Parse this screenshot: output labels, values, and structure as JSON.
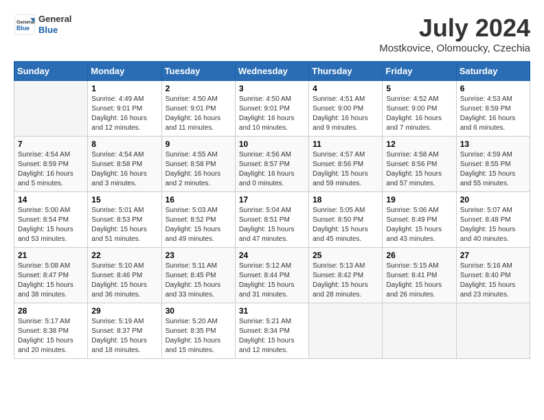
{
  "header": {
    "logo_general": "General",
    "logo_blue": "Blue",
    "month_title": "July 2024",
    "location": "Mostkovice, Olomoucky, Czechia"
  },
  "days_of_week": [
    "Sunday",
    "Monday",
    "Tuesday",
    "Wednesday",
    "Thursday",
    "Friday",
    "Saturday"
  ],
  "weeks": [
    [
      {
        "day": "",
        "info": ""
      },
      {
        "day": "1",
        "info": "Sunrise: 4:49 AM\nSunset: 9:01 PM\nDaylight: 16 hours\nand 12 minutes."
      },
      {
        "day": "2",
        "info": "Sunrise: 4:50 AM\nSunset: 9:01 PM\nDaylight: 16 hours\nand 11 minutes."
      },
      {
        "day": "3",
        "info": "Sunrise: 4:50 AM\nSunset: 9:01 PM\nDaylight: 16 hours\nand 10 minutes."
      },
      {
        "day": "4",
        "info": "Sunrise: 4:51 AM\nSunset: 9:00 PM\nDaylight: 16 hours\nand 9 minutes."
      },
      {
        "day": "5",
        "info": "Sunrise: 4:52 AM\nSunset: 9:00 PM\nDaylight: 16 hours\nand 7 minutes."
      },
      {
        "day": "6",
        "info": "Sunrise: 4:53 AM\nSunset: 8:59 PM\nDaylight: 16 hours\nand 6 minutes."
      }
    ],
    [
      {
        "day": "7",
        "info": "Sunrise: 4:54 AM\nSunset: 8:59 PM\nDaylight: 16 hours\nand 5 minutes."
      },
      {
        "day": "8",
        "info": "Sunrise: 4:54 AM\nSunset: 8:58 PM\nDaylight: 16 hours\nand 3 minutes."
      },
      {
        "day": "9",
        "info": "Sunrise: 4:55 AM\nSunset: 8:58 PM\nDaylight: 16 hours\nand 2 minutes."
      },
      {
        "day": "10",
        "info": "Sunrise: 4:56 AM\nSunset: 8:57 PM\nDaylight: 16 hours\nand 0 minutes."
      },
      {
        "day": "11",
        "info": "Sunrise: 4:57 AM\nSunset: 8:56 PM\nDaylight: 15 hours\nand 59 minutes."
      },
      {
        "day": "12",
        "info": "Sunrise: 4:58 AM\nSunset: 8:56 PM\nDaylight: 15 hours\nand 57 minutes."
      },
      {
        "day": "13",
        "info": "Sunrise: 4:59 AM\nSunset: 8:55 PM\nDaylight: 15 hours\nand 55 minutes."
      }
    ],
    [
      {
        "day": "14",
        "info": "Sunrise: 5:00 AM\nSunset: 8:54 PM\nDaylight: 15 hours\nand 53 minutes."
      },
      {
        "day": "15",
        "info": "Sunrise: 5:01 AM\nSunset: 8:53 PM\nDaylight: 15 hours\nand 51 minutes."
      },
      {
        "day": "16",
        "info": "Sunrise: 5:03 AM\nSunset: 8:52 PM\nDaylight: 15 hours\nand 49 minutes."
      },
      {
        "day": "17",
        "info": "Sunrise: 5:04 AM\nSunset: 8:51 PM\nDaylight: 15 hours\nand 47 minutes."
      },
      {
        "day": "18",
        "info": "Sunrise: 5:05 AM\nSunset: 8:50 PM\nDaylight: 15 hours\nand 45 minutes."
      },
      {
        "day": "19",
        "info": "Sunrise: 5:06 AM\nSunset: 8:49 PM\nDaylight: 15 hours\nand 43 minutes."
      },
      {
        "day": "20",
        "info": "Sunrise: 5:07 AM\nSunset: 8:48 PM\nDaylight: 15 hours\nand 40 minutes."
      }
    ],
    [
      {
        "day": "21",
        "info": "Sunrise: 5:08 AM\nSunset: 8:47 PM\nDaylight: 15 hours\nand 38 minutes."
      },
      {
        "day": "22",
        "info": "Sunrise: 5:10 AM\nSunset: 8:46 PM\nDaylight: 15 hours\nand 36 minutes."
      },
      {
        "day": "23",
        "info": "Sunrise: 5:11 AM\nSunset: 8:45 PM\nDaylight: 15 hours\nand 33 minutes."
      },
      {
        "day": "24",
        "info": "Sunrise: 5:12 AM\nSunset: 8:44 PM\nDaylight: 15 hours\nand 31 minutes."
      },
      {
        "day": "25",
        "info": "Sunrise: 5:13 AM\nSunset: 8:42 PM\nDaylight: 15 hours\nand 28 minutes."
      },
      {
        "day": "26",
        "info": "Sunrise: 5:15 AM\nSunset: 8:41 PM\nDaylight: 15 hours\nand 26 minutes."
      },
      {
        "day": "27",
        "info": "Sunrise: 5:16 AM\nSunset: 8:40 PM\nDaylight: 15 hours\nand 23 minutes."
      }
    ],
    [
      {
        "day": "28",
        "info": "Sunrise: 5:17 AM\nSunset: 8:38 PM\nDaylight: 15 hours\nand 20 minutes."
      },
      {
        "day": "29",
        "info": "Sunrise: 5:19 AM\nSunset: 8:37 PM\nDaylight: 15 hours\nand 18 minutes."
      },
      {
        "day": "30",
        "info": "Sunrise: 5:20 AM\nSunset: 8:35 PM\nDaylight: 15 hours\nand 15 minutes."
      },
      {
        "day": "31",
        "info": "Sunrise: 5:21 AM\nSunset: 8:34 PM\nDaylight: 15 hours\nand 12 minutes."
      },
      {
        "day": "",
        "info": ""
      },
      {
        "day": "",
        "info": ""
      },
      {
        "day": "",
        "info": ""
      }
    ]
  ]
}
